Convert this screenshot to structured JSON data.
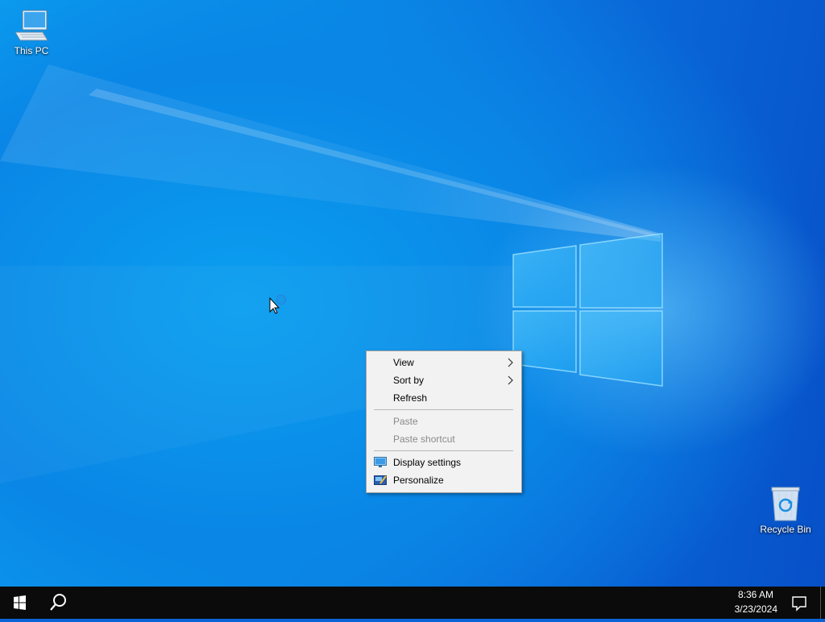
{
  "desktop": {
    "icons": [
      {
        "label": "This PC",
        "icon": "computer-icon"
      },
      {
        "label": "Recycle Bin",
        "icon": "recycle-bin-icon"
      }
    ]
  },
  "context_menu": {
    "items": [
      {
        "label": "View",
        "submenu": true,
        "enabled": true
      },
      {
        "label": "Sort by",
        "submenu": true,
        "enabled": true
      },
      {
        "label": "Refresh",
        "submenu": false,
        "enabled": true
      },
      {
        "label": "Paste",
        "submenu": false,
        "enabled": false
      },
      {
        "label": "Paste shortcut",
        "submenu": false,
        "enabled": false
      },
      {
        "label": "Display settings",
        "submenu": false,
        "enabled": true,
        "icon": "display-settings-icon"
      },
      {
        "label": "Personalize",
        "submenu": false,
        "enabled": true,
        "icon": "personalize-icon"
      }
    ]
  },
  "taskbar": {
    "start_icon": "windows-logo-icon",
    "search_icon": "search-icon",
    "time": "8:36 AM",
    "date": "3/23/2024",
    "notification_icon": "action-center-icon"
  },
  "colors": {
    "taskbar_bg": "#0b0b0b",
    "menu_bg": "#f2f2f2",
    "wallpaper_blue": "#0a86e6"
  }
}
